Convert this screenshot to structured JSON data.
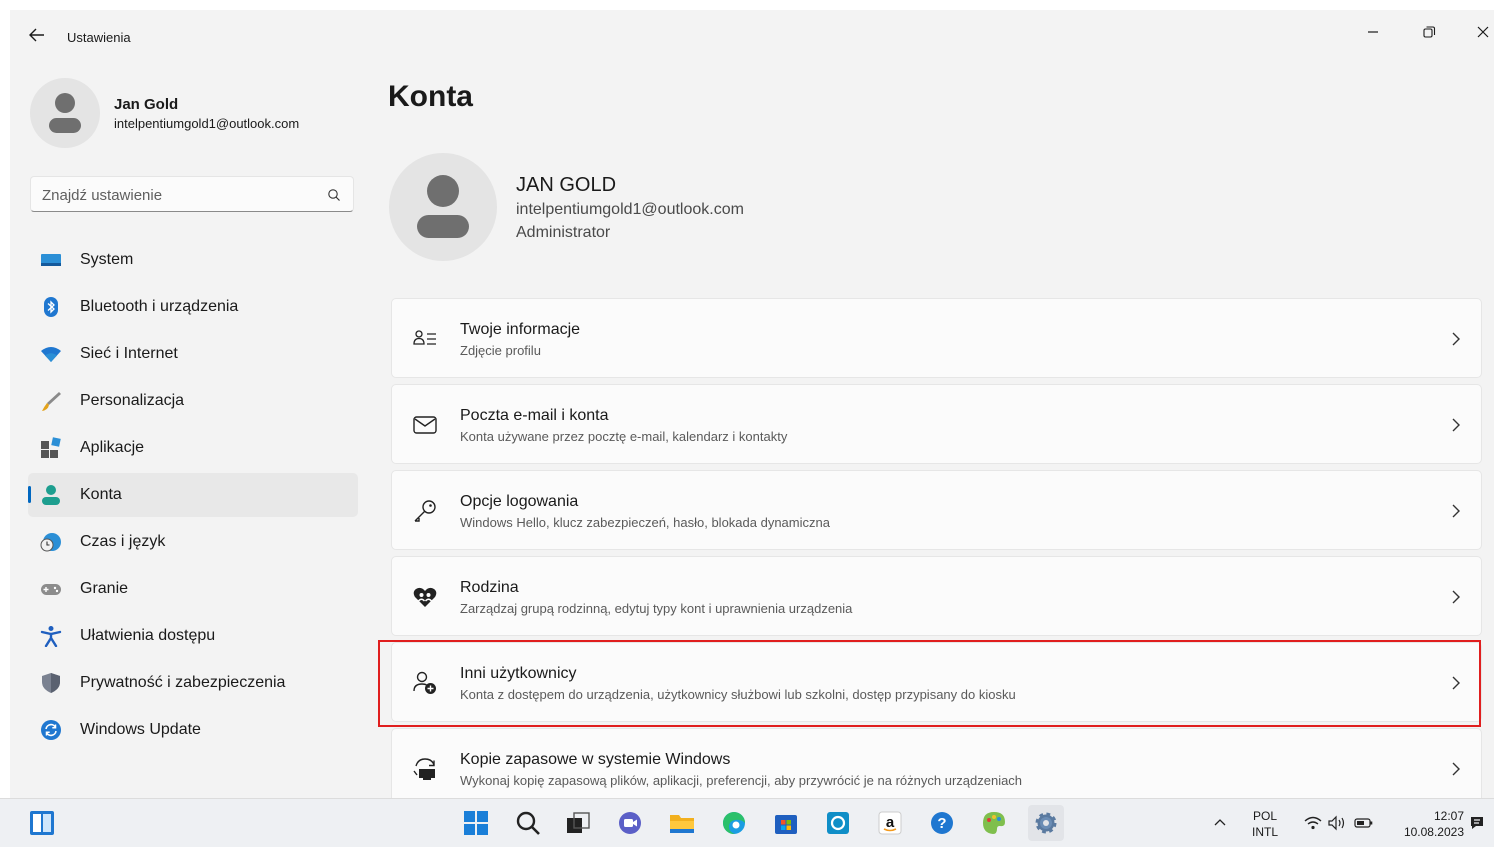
{
  "window": {
    "title": "Ustawienia"
  },
  "profile": {
    "name": "Jan Gold",
    "email": "intelpentiumgold1@outlook.com"
  },
  "search": {
    "placeholder": "Znajdź ustawienie"
  },
  "sidebar": {
    "items": [
      {
        "label": "System",
        "icon": "monitor-icon"
      },
      {
        "label": "Bluetooth i urządzenia",
        "icon": "bluetooth-icon"
      },
      {
        "label": "Sieć i Internet",
        "icon": "wifi-icon"
      },
      {
        "label": "Personalizacja",
        "icon": "brush-icon"
      },
      {
        "label": "Aplikacje",
        "icon": "apps-icon"
      },
      {
        "label": "Konta",
        "icon": "person-icon",
        "active": true
      },
      {
        "label": "Czas i język",
        "icon": "clock-globe-icon"
      },
      {
        "label": "Granie",
        "icon": "gamepad-icon"
      },
      {
        "label": "Ułatwienia dostępu",
        "icon": "accessibility-icon"
      },
      {
        "label": "Prywatność i zabezpieczenia",
        "icon": "shield-icon"
      },
      {
        "label": "Windows Update",
        "icon": "sync-icon"
      }
    ]
  },
  "main": {
    "title": "Konta",
    "account": {
      "name": "JAN GOLD",
      "email": "intelpentiumgold1@outlook.com",
      "role": "Administrator"
    },
    "cards": [
      {
        "title": "Twoje informacje",
        "subtitle": "Zdjęcie profilu",
        "icon": "person-list-icon"
      },
      {
        "title": "Poczta e-mail i konta",
        "subtitle": "Konta używane przez pocztę e-mail, kalendarz i kontakty",
        "icon": "mail-icon"
      },
      {
        "title": "Opcje logowania",
        "subtitle": "Windows Hello, klucz zabezpieczeń, hasło, blokada dynamiczna",
        "icon": "key-icon"
      },
      {
        "title": "Rodzina",
        "subtitle": "Zarządzaj grupą rodzinną, edytuj typy kont i uprawnienia urządzenia",
        "icon": "family-heart-icon"
      },
      {
        "title": "Inni użytkownicy",
        "subtitle": "Konta z dostępem do urządzenia, użytkownicy służbowi lub szkolni, dostęp przypisany do kiosku",
        "icon": "person-add-icon"
      },
      {
        "title": "Kopie zapasowe w systemie Windows",
        "subtitle": "Wykonaj kopię zapasową plików, aplikacji, preferencji, aby przywrócić je na różnych urządzeniach",
        "icon": "backup-icon"
      }
    ]
  },
  "taskbar": {
    "lang_top": "POL",
    "lang_bottom": "INTL",
    "time": "12:07",
    "date": "10.08.2023",
    "amazon_glyph": "a",
    "help_glyph": "?"
  },
  "colors": {
    "accent": "#0067c0",
    "highlight_border": "#e01e1e",
    "background": "#f3f3f3",
    "card": "#fbfbfb"
  }
}
